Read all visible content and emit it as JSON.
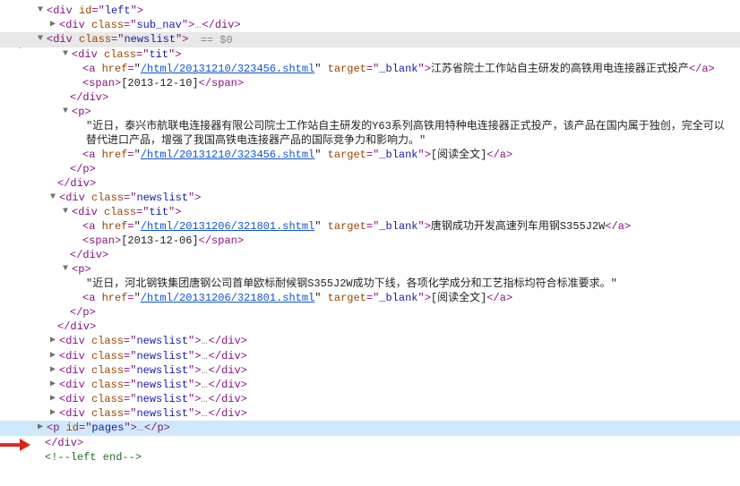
{
  "root": {
    "open": "<div id=\"left\">",
    "close": "</div>",
    "close_comment": "<!--left end-->"
  },
  "sub_nav": {
    "open": "<div class=\"sub_nav\">",
    "close": "</div>",
    "ellipsis": "…"
  },
  "newslist": {
    "open_tag": "<div class=\"newslist\">",
    "close_tag": "</div>",
    "annot": " == $0"
  },
  "tit": {
    "open": "<div class=\"tit\">",
    "close": "</div>"
  },
  "p": {
    "open": "<p>",
    "close": "</p>"
  },
  "span": {
    "open": "<span>",
    "close": "</span>"
  },
  "a": {
    "open": "<a",
    "close": "</a>",
    "target_label": "target",
    "target_val": "_blank",
    "href_label": "href"
  },
  "items": [
    {
      "href": "/html/20131210/323456.shtml",
      "title": "江苏省院士工作站自主研发的高铁用电连接器正式投产",
      "date": "[2013-12-10]",
      "desc": "近日，泰兴市航联电连接器有限公司院士工作站自主研发的Y63系列高铁用特种电连接器正式投产，该产品在国内属于独创，完全可以替代进口产品，增强了我国高铁电连接器产品的国际竞争力和影响力。",
      "readmore": "[阅读全文]"
    },
    {
      "href": "/html/20131206/321801.shtml",
      "title": "唐钢成功开发高速列车用钢S355J2W",
      "date": "[2013-12-06]",
      "desc": "近日，河北钢铁集团唐钢公司首单欧标耐候钢S355J2W成功下线，各项化学成分和工艺指标均符合标准要求。",
      "readmore": "[阅读全文]"
    }
  ],
  "collapsed_count": 6,
  "pages": {
    "open": "<p id=\"pages\">",
    "close": "</p>",
    "ellipsis": "…"
  },
  "generic_ellipsis": "…",
  "quote_char": "\""
}
